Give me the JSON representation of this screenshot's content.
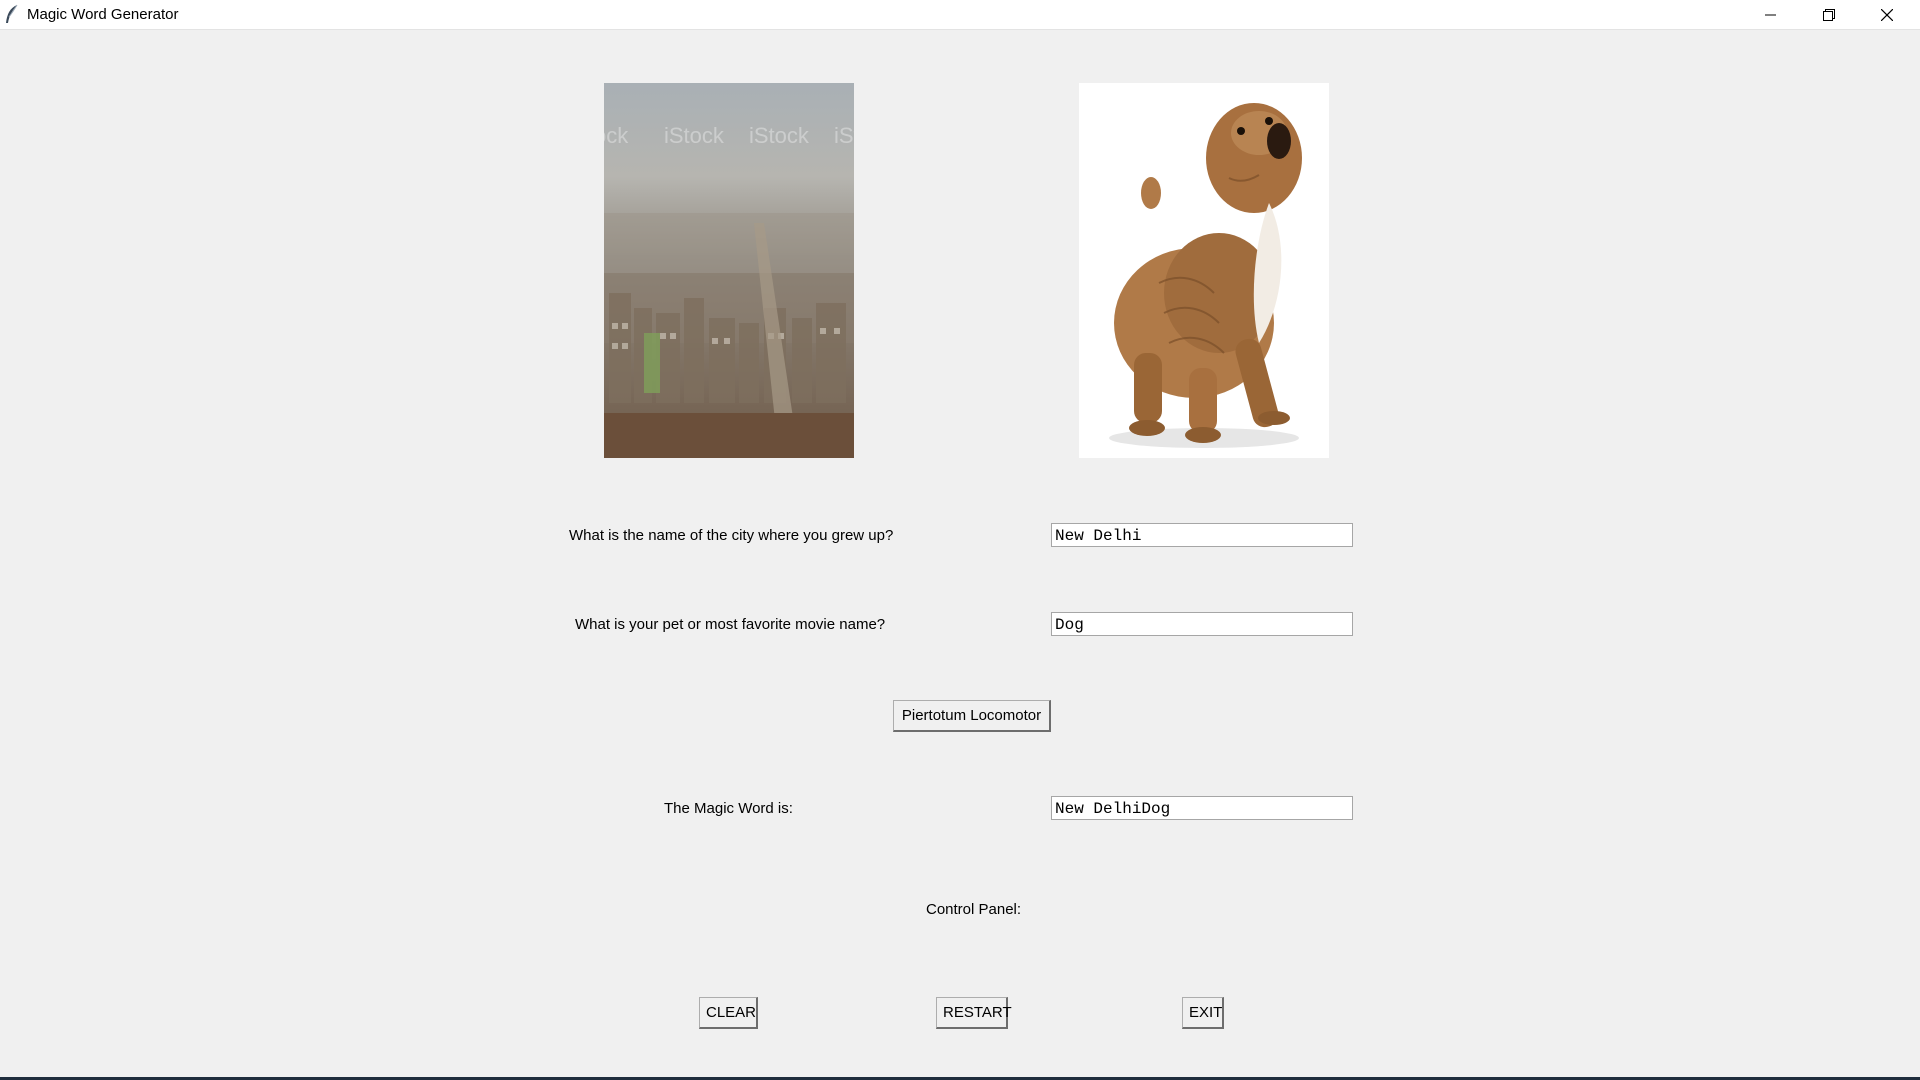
{
  "window": {
    "title": "Magic Word Generator",
    "icon": "feather-icon"
  },
  "images": {
    "city": {
      "name": "city-photo",
      "watermark": "iStock"
    },
    "pet": {
      "name": "bulldog-puppy-photo"
    }
  },
  "form": {
    "city_label": "What is the name of the city where you grew up?",
    "city_value": "New Delhi",
    "pet_label": "What is your pet or most favorite movie name?",
    "pet_value": "Dog",
    "generate_button": "Piertotum Locomotor",
    "result_label": "The Magic Word is:",
    "result_value": "New DelhiDog"
  },
  "control_panel": {
    "label": "Control Panel:",
    "clear_button": "CLEAR",
    "restart_button": "RESTART",
    "exit_button": "EXIT"
  },
  "colors": {
    "background": "#f0f0f0",
    "titlebar": "#ffffff"
  }
}
